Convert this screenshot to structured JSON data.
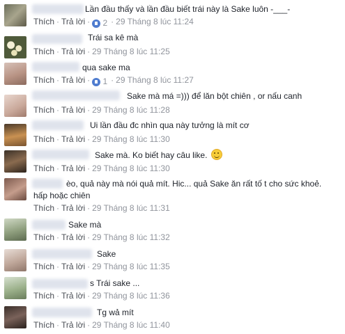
{
  "actions": {
    "like_label": "Thích",
    "reply_label": "Trả lời",
    "separator": "·"
  },
  "comments": [
    {
      "text": "Lần đầu thấy và lần đầu biết trái này là Sake luôn -___-",
      "reaction_count": "2",
      "time": "29 Tháng 8 lúc 11:24"
    },
    {
      "text": "Trái sa kê mà",
      "time": "29 Tháng 8 lúc 11:25"
    },
    {
      "text": "qua sake ma",
      "reaction_count": "1",
      "time": "29 Tháng 8 lúc 11:27"
    },
    {
      "text": "Sake mà má =))) để lăn bột chiên , or nấu canh",
      "time": "29 Tháng 8 lúc 11:28"
    },
    {
      "text": "Ui lần đầu đc nhìn qua này tưởng là mít cơ",
      "time": "29 Tháng 8 lúc 11:30"
    },
    {
      "text": "Sake mà. Ko biết hay câu like.",
      "emoji": "smile-emoji",
      "time": "29 Tháng 8 lúc 11:30"
    },
    {
      "text": "èo, quả này mà nói quả mít. Hic... quả Sake ăn rất tố t cho sức khoẻ.",
      "text_line2": "hấp hoặc chiên",
      "time": "29 Tháng 8 lúc 11:31"
    },
    {
      "text": "Sake mà",
      "time": "29 Tháng 8 lúc 11:32"
    },
    {
      "text": "Sake",
      "time": "29 Tháng 8 lúc 11:35"
    },
    {
      "text": "s Trái sake ...",
      "time": "29 Tháng 8 lúc 11:36"
    },
    {
      "text": "Tg wả mít",
      "time": "29 Tháng 8 lúc 11:40"
    }
  ]
}
